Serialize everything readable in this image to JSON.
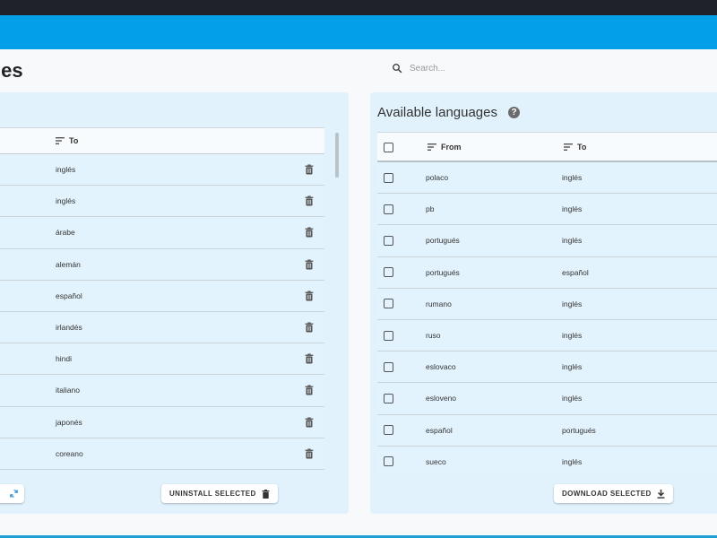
{
  "page": {
    "title": "uages"
  },
  "search": {
    "placeholder": "Search..."
  },
  "installed": {
    "to_header": "To",
    "rows": [
      {
        "to": "inglés"
      },
      {
        "to": "inglés"
      },
      {
        "to": "árabe"
      },
      {
        "to": "alemán"
      },
      {
        "to": "español"
      },
      {
        "to": "irlandés"
      },
      {
        "to": "hindi"
      },
      {
        "to": "italiano"
      },
      {
        "to": "japonés"
      },
      {
        "to": "coreano"
      }
    ],
    "uninstall_label": "UNINSTALL SELECTED"
  },
  "available": {
    "title": "Available languages",
    "help_glyph": "?",
    "from_header": "From",
    "to_header": "To",
    "rows": [
      {
        "from": "polaco",
        "to": "inglés"
      },
      {
        "from": "pb",
        "to": "inglés"
      },
      {
        "from": "portugués",
        "to": "inglés"
      },
      {
        "from": "portugués",
        "to": "español"
      },
      {
        "from": "rumano",
        "to": "inglés"
      },
      {
        "from": "ruso",
        "to": "inglés"
      },
      {
        "from": "eslovaco",
        "to": "inglés"
      },
      {
        "from": "esloveno",
        "to": "inglés"
      },
      {
        "from": "español",
        "to": "portugués"
      },
      {
        "from": "sueco",
        "to": "inglés"
      }
    ],
    "download_label": "DOWNLOAD SELECTED"
  },
  "icons": {
    "search": "search-icon",
    "sort": "sort-icon",
    "trash": "trash-icon",
    "download": "download-icon",
    "refresh": "refresh-icon",
    "help": "help-icon"
  },
  "colors": {
    "app_bar": "#03a0e9",
    "panel_bg": "#e1f2fd",
    "top_bar": "#1f2329"
  }
}
